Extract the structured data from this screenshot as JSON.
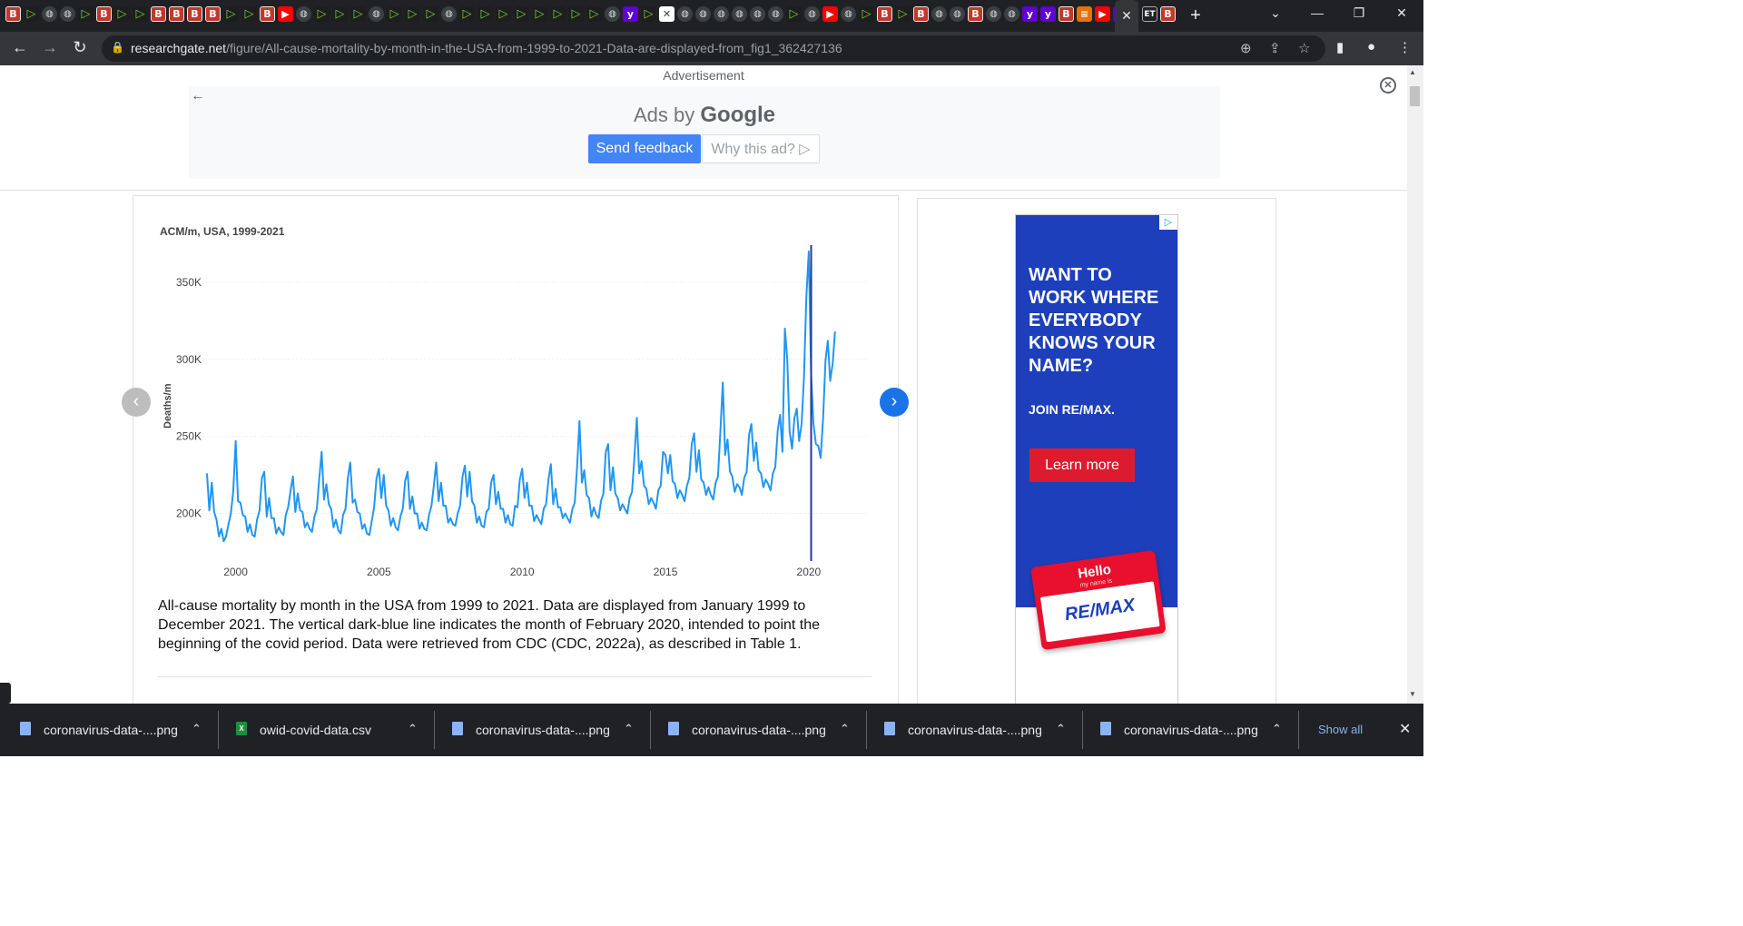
{
  "browser": {
    "active_tab_close": "✕",
    "new_tab": "+",
    "url_host": "researchgate.net",
    "url_path": "/figure/All-cause-mortality-by-month-in-the-USA-from-1999-to-2021-Data-are-displayed-from_fig1_362427136",
    "inactive_tab_label": "ET"
  },
  "ad_banner": {
    "label": "Advertisement",
    "ads_by": "Ads by",
    "google": "Google",
    "send_feedback": "Send feedback",
    "why_this_ad": "Why this ad? ▷"
  },
  "figure": {
    "caption": "All-cause mortality by month in the USA from 1999 to 2021. Data are displayed from January 1999 to December 2021. The vertical dark-blue line indicates the month of February 2020, intended to point the beginning of the covid period. Data were retrieved from CDC (CDC, 2022a), as described in Table 1."
  },
  "side_ad": {
    "headline": "WANT TO WORK WHERE EVERYBODY KNOWS YOUR NAME?",
    "join": "JOIN RE/MAX.",
    "cta": "Learn more",
    "tag_hello": "Hello",
    "tag_sub": "my name is",
    "tag_name": "RE/MAX"
  },
  "downloads": {
    "items": [
      {
        "name": "coronavirus-data-....png",
        "type": "png"
      },
      {
        "name": "owid-covid-data.csv",
        "type": "csv"
      },
      {
        "name": "coronavirus-data-....png",
        "type": "png"
      },
      {
        "name": "coronavirus-data-....png",
        "type": "png"
      },
      {
        "name": "coronavirus-data-....png",
        "type": "png"
      },
      {
        "name": "coronavirus-data-....png",
        "type": "png"
      }
    ],
    "show_all": "Show all"
  },
  "colors": {
    "series": "#2196f3",
    "marker_line": "#283593",
    "axis_text": "#444444"
  },
  "chart_data": {
    "type": "line",
    "title": "ACM/m, USA, 1999-2021",
    "xlabel": "",
    "ylabel": "Deaths/m",
    "x_start": "1999-01",
    "x_end": "2021-12",
    "x_ticks": [
      2000,
      2005,
      2010,
      2015,
      2020
    ],
    "y_ticks": [
      200000,
      250000,
      300000,
      350000
    ],
    "y_tick_labels": [
      "200K",
      "250K",
      "300K",
      "350K"
    ],
    "ylim": [
      175000,
      380000
    ],
    "grid": true,
    "vertical_marker": {
      "x": "2020-02"
    },
    "series": [
      {
        "values_by_year": [
          [
            226000,
            202000,
            220000,
            201000,
            196000,
            185000,
            190000,
            182000,
            185000,
            193000,
            200000,
            214000
          ],
          [
            247000,
            208000,
            207000,
            199000,
            198000,
            188000,
            193000,
            186000,
            185000,
            196000,
            202000,
            223000
          ],
          [
            227000,
            198000,
            210000,
            197000,
            197000,
            187000,
            191000,
            188000,
            186000,
            199000,
            204000,
            215000
          ],
          [
            224000,
            201000,
            213000,
            202000,
            201000,
            191000,
            194000,
            190000,
            188000,
            198000,
            203000,
            222000
          ],
          [
            240000,
            209000,
            219000,
            206000,
            203000,
            191000,
            196000,
            189000,
            187000,
            199000,
            203000,
            223000
          ],
          [
            233000,
            207000,
            209000,
            201000,
            200000,
            190000,
            193000,
            187000,
            186000,
            195000,
            204000,
            223000
          ],
          [
            229000,
            210000,
            225000,
            205000,
            202000,
            192000,
            197000,
            191000,
            189000,
            198000,
            203000,
            221000
          ],
          [
            227000,
            203000,
            211000,
            200000,
            200000,
            190000,
            194000,
            190000,
            189000,
            199000,
            205000,
            218000
          ],
          [
            233000,
            208000,
            220000,
            205000,
            205000,
            194000,
            197000,
            193000,
            192000,
            200000,
            205000,
            224000
          ],
          [
            231000,
            211000,
            227000,
            208000,
            205000,
            194000,
            198000,
            192000,
            191000,
            201000,
            203000,
            220000
          ],
          [
            225000,
            206000,
            214000,
            203000,
            203000,
            194000,
            199000,
            193000,
            192000,
            205000,
            204000,
            222000
          ],
          [
            229000,
            210000,
            220000,
            205000,
            205000,
            195000,
            199000,
            196000,
            193000,
            203000,
            206000,
            222000
          ],
          [
            232000,
            206000,
            216000,
            204000,
            204000,
            197000,
            200000,
            197000,
            194000,
            203000,
            207000,
            230000
          ],
          [
            260000,
            220000,
            228000,
            212000,
            210000,
            198000,
            204000,
            199000,
            197000,
            208000,
            213000,
            240000
          ],
          [
            245000,
            215000,
            230000,
            213000,
            210000,
            202000,
            206000,
            203000,
            200000,
            210000,
            214000,
            236000
          ],
          [
            262000,
            226000,
            234000,
            218000,
            216000,
            206000,
            210000,
            207000,
            203000,
            215000,
            218000,
            240000
          ],
          [
            238000,
            226000,
            238000,
            221000,
            219000,
            210000,
            215000,
            212000,
            208000,
            218000,
            223000,
            245000
          ],
          [
            252000,
            227000,
            241000,
            222000,
            220000,
            212000,
            217000,
            212000,
            209000,
            220000,
            224000,
            253000
          ],
          [
            285000,
            238000,
            248000,
            227000,
            224000,
            214000,
            219000,
            217000,
            212000,
            223000,
            227000,
            251000
          ],
          [
            258000,
            234000,
            246000,
            228000,
            226000,
            217000,
            222000,
            219000,
            215000,
            226000,
            230000,
            254000
          ],
          [
            264000,
            240000,
            320000,
            300000,
            253000,
            242000,
            262000,
            268000,
            247000,
            258000,
            288000,
            340000
          ],
          [
            370000,
            290000,
            258000,
            245000,
            244000,
            236000,
            262000,
            299000,
            312000,
            286000,
            297000,
            318000
          ]
        ]
      }
    ]
  }
}
